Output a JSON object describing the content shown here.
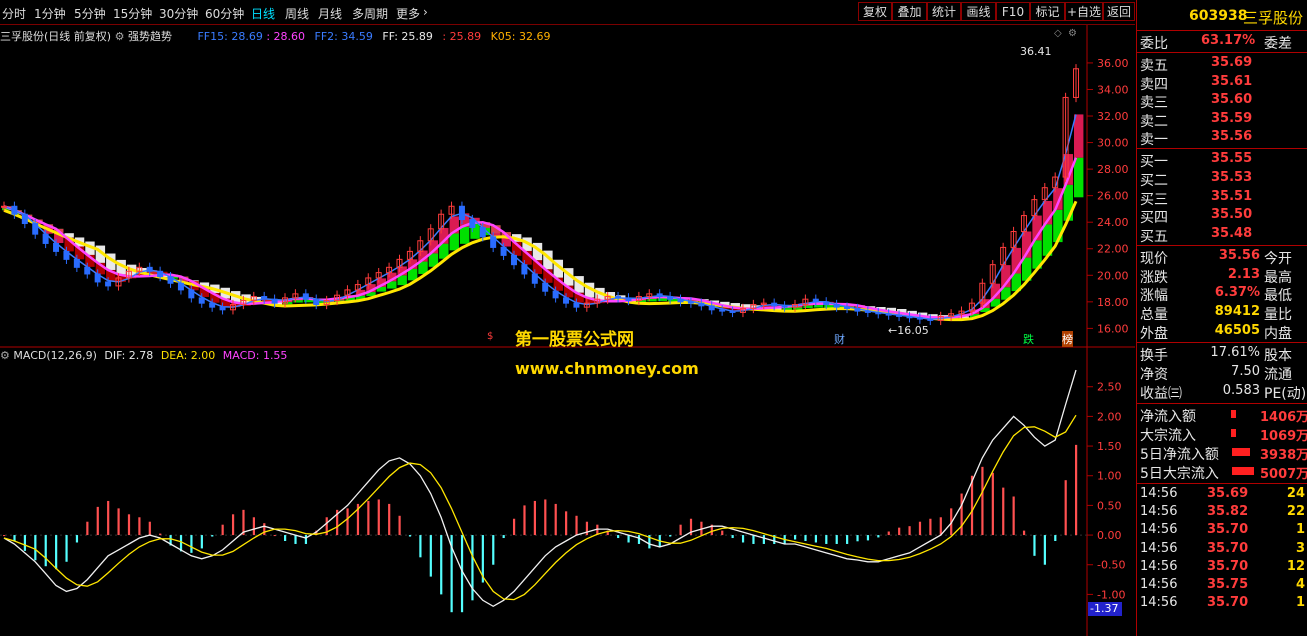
{
  "toolbar": {
    "periods": [
      "分时",
      "1分钟",
      "5分钟",
      "15分钟",
      "30分钟",
      "60分钟",
      "日线",
      "周线",
      "月线",
      "多周期",
      "更多"
    ],
    "active_period": "日线",
    "tools": [
      "复权",
      "叠加",
      "统计",
      "画线",
      "F10",
      "标记",
      "+自选",
      "返回"
    ]
  },
  "kline_legend": {
    "name": "三孚股份(日线 前复权)",
    "indicator": "强势趋势",
    "ff15": "FF15: 28.69",
    "ff15b": ": 28.60",
    "ff2": "FF2: 34.59",
    "ff": "FF: 25.89",
    "ffb": ": 25.89",
    "k05": "K05: 32.69"
  },
  "kline_annotations": {
    "high_price": "36.41",
    "low_price": "16.05",
    "marks": [
      "财",
      "跌",
      "榜",
      "$"
    ]
  },
  "watermark": {
    "line1": "第一股票公式网",
    "line2": "www.chnmoney.com"
  },
  "macd_legend": {
    "name": "MACD(12,26,9)",
    "dif": "DIF: 2.78",
    "dea": "DEA: 2.00",
    "macd": "MACD: 1.55"
  },
  "price_axis": [
    "36.00",
    "34.00",
    "32.00",
    "30.00",
    "28.00",
    "26.00",
    "24.00",
    "22.00",
    "20.00",
    "18.00",
    "16.00"
  ],
  "macd_axis": [
    "2.50",
    "2.00",
    "1.50",
    "1.00",
    "0.50",
    "0.00",
    "-0.50",
    "-1.00"
  ],
  "macd_axis_current": "-1.37",
  "stock": {
    "code": "603938",
    "name": "三孚股份"
  },
  "quote": {
    "weibi_label": "委比",
    "weibi_value": "63.17%",
    "weicha_label": "委差",
    "sells": [
      {
        "label": "卖五",
        "price": "35.69"
      },
      {
        "label": "卖四",
        "price": "35.61"
      },
      {
        "label": "卖三",
        "price": "35.60"
      },
      {
        "label": "卖二",
        "price": "35.59"
      },
      {
        "label": "卖一",
        "price": "35.56"
      }
    ],
    "buys": [
      {
        "label": "买一",
        "price": "35.55"
      },
      {
        "label": "买二",
        "price": "35.53"
      },
      {
        "label": "买三",
        "price": "35.51"
      },
      {
        "label": "买四",
        "price": "35.50"
      },
      {
        "label": "买五",
        "price": "35.48"
      }
    ],
    "stats": [
      {
        "label": "现价",
        "value": "35.56",
        "label2": "今开"
      },
      {
        "label": "涨跌",
        "value": "2.13",
        "label2": "最高"
      },
      {
        "label": "涨幅",
        "value": "6.37%",
        "label2": "最低"
      },
      {
        "label": "总量",
        "value": "89412",
        "label2": "量比"
      },
      {
        "label": "外盘",
        "value": "46505",
        "label2": "内盘"
      }
    ],
    "stats2": [
      {
        "label": "换手",
        "value": "17.61%",
        "label2": "股本"
      },
      {
        "label": "净资",
        "value": "7.50",
        "label2": "流通"
      },
      {
        "label": "收益㈢",
        "value": "0.583",
        "label2": "PE(动)"
      }
    ],
    "flows": [
      {
        "label": "净流入额",
        "value": "1406万"
      },
      {
        "label": "大宗流入",
        "value": "1069万"
      },
      {
        "label": "5日净流入额",
        "value": "3938万"
      },
      {
        "label": "5日大宗流入",
        "value": "5007万"
      }
    ],
    "ticks": [
      {
        "time": "14:56",
        "price": "35.69",
        "vol": "24"
      },
      {
        "time": "14:56",
        "price": "35.82",
        "vol": "22"
      },
      {
        "time": "14:56",
        "price": "35.70",
        "vol": "1"
      },
      {
        "time": "14:56",
        "price": "35.70",
        "vol": "3"
      },
      {
        "time": "14:56",
        "price": "35.70",
        "vol": "12"
      },
      {
        "time": "14:56",
        "price": "35.75",
        "vol": "4"
      },
      {
        "time": "14:56",
        "price": "35.70",
        "vol": "1"
      }
    ]
  },
  "colors": {
    "up": "#ff3c3c",
    "down": "#54ffff",
    "accent": "#ffd800",
    "border": "#b00000"
  },
  "chart_data": [
    {
      "type": "candlestick",
      "title": "三孚股份(日线 前复权)",
      "ylim": [
        15.2,
        37.2
      ],
      "close": [
        25.2,
        24.6,
        23.9,
        23.1,
        22.4,
        21.8,
        21.2,
        20.6,
        20.1,
        19.5,
        19.2,
        19.8,
        20.3,
        20.6,
        20.3,
        19.9,
        19.4,
        18.9,
        18.3,
        17.9,
        17.6,
        17.4,
        17.8,
        18.1,
        18.4,
        18.2,
        17.9,
        18.3,
        18.6,
        18.2,
        17.8,
        18.1,
        18.5,
        18.9,
        19.3,
        19.8,
        20.2,
        20.6,
        21.2,
        21.8,
        22.6,
        23.5,
        24.6,
        25.2,
        24.2,
        23.6,
        22.9,
        22.1,
        21.5,
        20.8,
        20.1,
        19.4,
        18.8,
        18.3,
        17.9,
        17.6,
        17.9,
        18.2,
        18.4,
        18.3,
        18.1,
        18.4,
        18.6,
        18.4,
        18.2,
        18.0,
        17.9,
        17.7,
        17.4,
        17.3,
        17.2,
        17.5,
        17.8,
        17.9,
        17.7,
        17.6,
        17.8,
        18.2,
        18.0,
        17.8,
        17.6,
        17.5,
        17.3,
        17.2,
        17.1,
        17.0,
        16.9,
        16.8,
        16.7,
        16.6,
        16.9,
        17.1,
        17.3,
        17.9,
        19.4,
        20.8,
        22.1,
        23.3,
        24.5,
        25.7,
        26.6,
        27.4,
        33.4,
        35.56
      ],
      "dif": [
        -0.05,
        -0.15,
        -0.3,
        -0.45,
        -0.65,
        -0.85,
        -0.95,
        -0.9,
        -0.75,
        -0.55,
        -0.35,
        -0.25,
        -0.15,
        -0.05,
        0.0,
        -0.05,
        -0.15,
        -0.25,
        -0.35,
        -0.4,
        -0.35,
        -0.25,
        -0.1,
        0.05,
        0.1,
        0.15,
        0.1,
        0.05,
        0.0,
        -0.05,
        0.05,
        0.2,
        0.35,
        0.5,
        0.7,
        0.9,
        1.1,
        1.25,
        1.3,
        1.2,
        1.0,
        0.7,
        0.3,
        -0.2,
        -0.6,
        -0.9,
        -1.1,
        -1.2,
        -1.1,
        -0.95,
        -0.75,
        -0.55,
        -0.35,
        -0.2,
        -0.1,
        0.0,
        0.05,
        0.1,
        0.1,
        0.05,
        0.0,
        -0.05,
        -0.15,
        -0.2,
        -0.15,
        -0.05,
        0.05,
        0.1,
        0.15,
        0.15,
        0.1,
        0.05,
        0.0,
        -0.05,
        -0.1,
        -0.15,
        -0.15,
        -0.2,
        -0.25,
        -0.3,
        -0.35,
        -0.4,
        -0.42,
        -0.45,
        -0.45,
        -0.4,
        -0.35,
        -0.3,
        -0.2,
        -0.1,
        0.0,
        0.2,
        0.5,
        0.9,
        1.3,
        1.6,
        1.8,
        2.0,
        1.85,
        1.65,
        1.5,
        1.6,
        2.2,
        2.78
      ]
    },
    {
      "type": "bar",
      "title": "MACD(12,26,9)",
      "ylim": [
        -1.6,
        2.9
      ]
    }
  ]
}
